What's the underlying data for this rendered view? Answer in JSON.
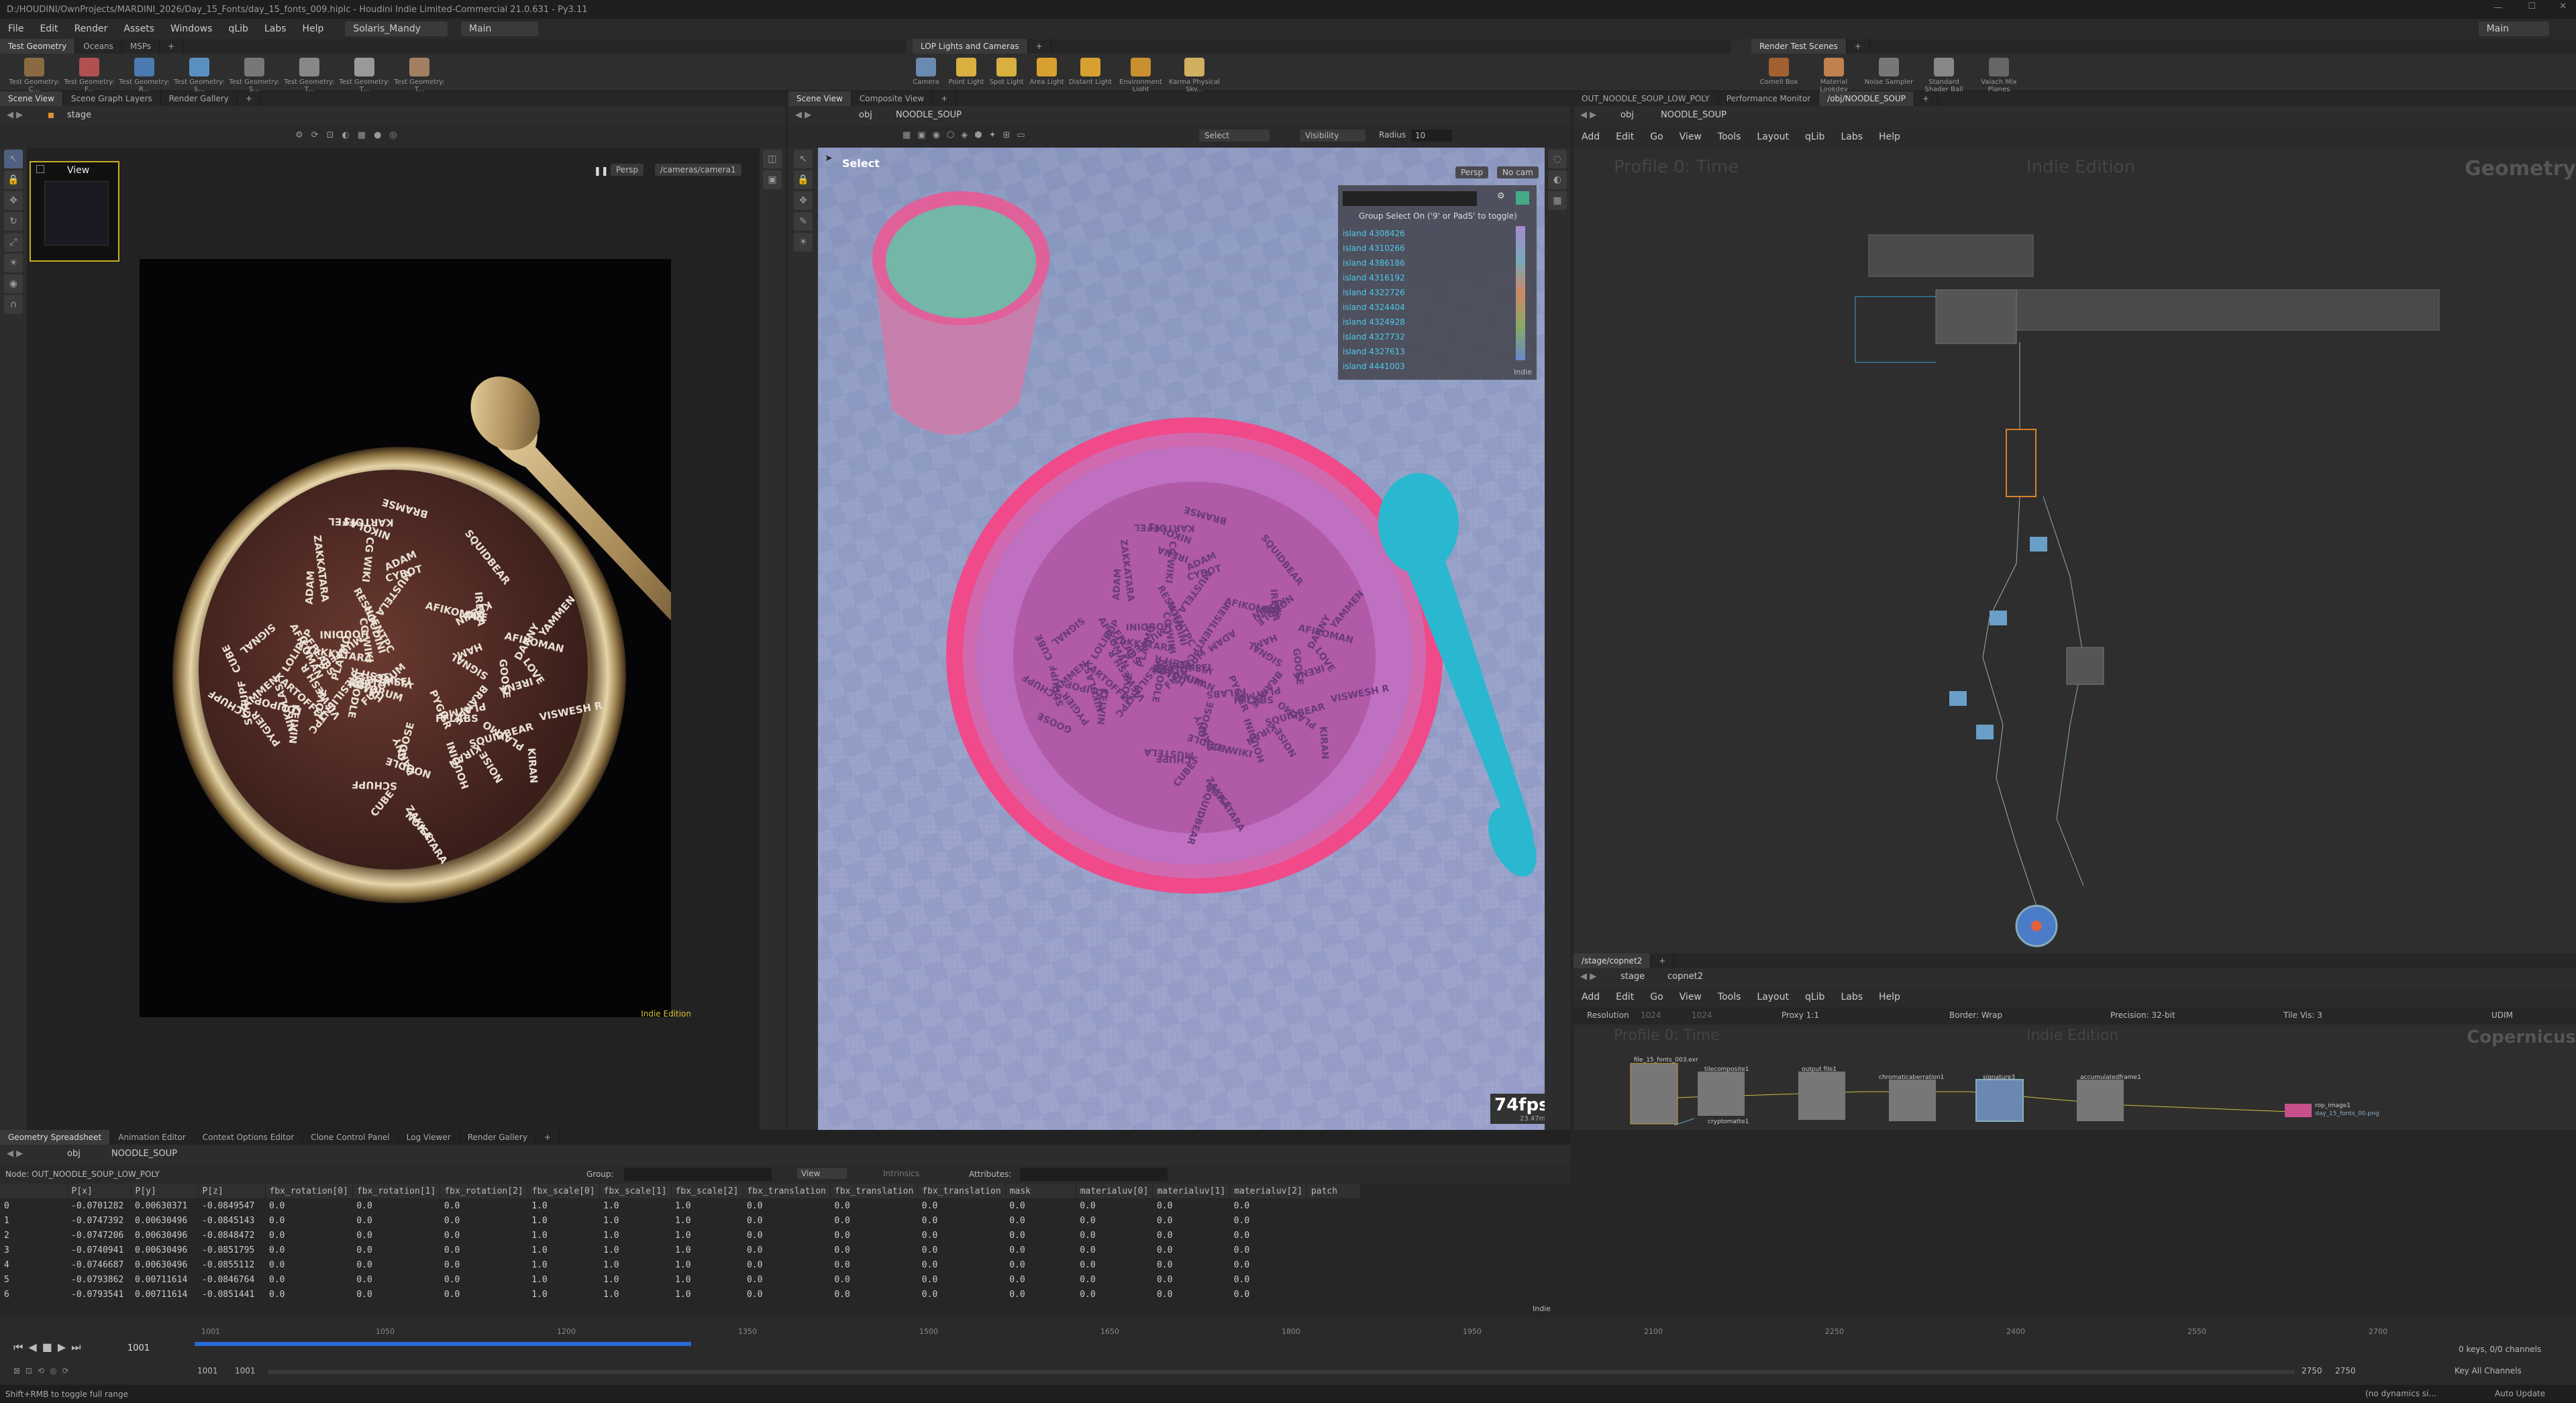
{
  "title": "D:/HOUDINI/OwnProjects/MARDINI_2026/Day_15_Fonts/day_15_fonts_009.hiplc - Houdini Indie Limited-Commercial 21.0.631 - Py3.11",
  "menu": [
    "File",
    "Edit",
    "Render",
    "Assets",
    "Windows",
    "qLib",
    "Labs",
    "Help"
  ],
  "desktop": "Solaris_Mandy",
  "context": "Main",
  "workspace": "Main",
  "shelf_tabs_left": [
    "Test Geometry",
    "Oceans",
    "MSPs",
    "+"
  ],
  "shelf_tools_left": [
    "Test Geometry: C...",
    "Test Geometry: F...",
    "Test Geometry: R...",
    "Test Geometry: S...",
    "Test Geometry: S...",
    "Test Geometry: T...",
    "Test Geometry: T...",
    "Test Geometry: T..."
  ],
  "shelf_tabs_mid": [
    "LOP Lights and Cameras",
    "+"
  ],
  "shelf_tools_mid": [
    "Camera",
    "Point Light",
    "Spot Light",
    "Area Light",
    "Distant Light",
    "Environment Light",
    "Karma Physical Sky..."
  ],
  "shelf_tabs_right": [
    "Render Test Scenes",
    "+"
  ],
  "shelf_tools_right": [
    "Cornell Box",
    "Material Lookdev",
    "Noise Sampler",
    "Standard Shader Ball",
    "Vaiach Mix Planes"
  ],
  "left_pane": {
    "tabs": [
      "Scene View",
      "Scene Graph Layers",
      "Render Gallery",
      "+"
    ],
    "path": "stage",
    "view_label": "View",
    "persp": "Persp",
    "camera": "/cameras/camera1",
    "edition": "Indie Edition"
  },
  "mid_pane": {
    "tabs": [
      "Scene View",
      "Composite View",
      "+"
    ],
    "path_obj": "obj",
    "path_node": "NOODLE_SOUP",
    "mode": "Select",
    "select_dropdown": "Select",
    "visibility": "Visibility",
    "radius_label": "Radius",
    "radius_value": "10",
    "persp": "Persp",
    "nocam": "No cam",
    "fps": "74fps",
    "fps_sub": "23.47ms",
    "popup_title": "Group Select On ('9' or PadS' to toggle)",
    "popup_edition": "Indie",
    "islands": [
      "island 4308426",
      "island 4310266",
      "island 4386186",
      "island 4316192",
      "island 4322726",
      "island 4324404",
      "island 4324928",
      "island 4327732",
      "island 4327613",
      "island 4441003"
    ]
  },
  "right_top": {
    "tabs": [
      "OUT_NOODLE_SOUP_LOW_POLY",
      "Performance Monitor",
      "/obj/NOODLE_SOUP",
      "+"
    ],
    "path_obj": "obj",
    "path_node": "NOODLE_SOUP",
    "menu": [
      "Add",
      "Edit",
      "Go",
      "View",
      "Tools",
      "Layout",
      "qLib",
      "Labs",
      "Help"
    ],
    "watermark_left": "Profile 0: Time",
    "watermark_mid": "Indie Edition",
    "context_label": "Geometry"
  },
  "right_bottom": {
    "tabs": [
      "/stage/copnet2",
      "+"
    ],
    "path_stage": "stage",
    "path_node": "copnet2",
    "menu": [
      "Add",
      "Edit",
      "Go",
      "View",
      "Tools",
      "Layout",
      "qLib",
      "Labs",
      "Help"
    ],
    "resolution_label": "Resolution",
    "res_w": "1024",
    "res_h": "1024",
    "proxy": "Proxy 1:1",
    "border": "Border: Wrap",
    "precision": "Precision: 32-bit",
    "tilevis": "Tile Vis: 3",
    "udim": "UDIM",
    "watermark_left": "Profile 0: Time",
    "watermark_mid": "Indie Edition",
    "context_label": "Copernicus",
    "nodes": [
      "file_15_fonts_003.exr",
      "tilecomposite1",
      "output\nfile1",
      "chromaticaberration1",
      "signature3",
      "accumulatedframe1"
    ],
    "node_extra": "cryptomatte1",
    "rop_label": "rop_image1",
    "rop_sub": "day_15_fonts_00.png"
  },
  "spreadsheet": {
    "tabs": [
      "Geometry Spreadsheet",
      "Animation Editor",
      "Context Options Editor",
      "Clone Control Panel",
      "Log Viewer",
      "Render Gallery",
      "+"
    ],
    "path_obj": "obj",
    "path_node": "NOODLE_SOUP",
    "node_label": "Node: OUT_NOODLE_SOUP_LOW_POLY",
    "group_label": "Group:",
    "view_label": "View",
    "intrinsics": "Intrinsics",
    "attributes": "Attributes:",
    "edition": "Indie",
    "columns": [
      "",
      "P[x]",
      "P[y]",
      "P[z]",
      "fbx_rotation[0]",
      "fbx_rotation[1]",
      "fbx_rotation[2]",
      "fbx_scale[0]",
      "fbx_scale[1]",
      "fbx_scale[2]",
      "fbx_translation",
      "fbx_translation",
      "fbx_translation",
      "mask",
      "materialuv[0]",
      "materialuv[1]",
      "materialuv[2]",
      "patch"
    ],
    "rows": [
      [
        "0",
        "-0.0701282",
        "0.00630371",
        "-0.0849547",
        "0.0",
        "0.0",
        "0.0",
        "1.0",
        "1.0",
        "1.0",
        "0.0",
        "0.0",
        "0.0",
        "0.0",
        "0.0",
        "0.0",
        "0.0",
        ""
      ],
      [
        "1",
        "-0.0747392",
        "0.00630496",
        "-0.0845143",
        "0.0",
        "0.0",
        "0.0",
        "1.0",
        "1.0",
        "1.0",
        "0.0",
        "0.0",
        "0.0",
        "0.0",
        "0.0",
        "0.0",
        "0.0",
        ""
      ],
      [
        "2",
        "-0.0747206",
        "0.00630496",
        "-0.0848472",
        "0.0",
        "0.0",
        "0.0",
        "1.0",
        "1.0",
        "1.0",
        "0.0",
        "0.0",
        "0.0",
        "0.0",
        "0.0",
        "0.0",
        "0.0",
        ""
      ],
      [
        "3",
        "-0.0740941",
        "0.00630496",
        "-0.0851795",
        "0.0",
        "0.0",
        "0.0",
        "1.0",
        "1.0",
        "1.0",
        "0.0",
        "0.0",
        "0.0",
        "0.0",
        "0.0",
        "0.0",
        "0.0",
        ""
      ],
      [
        "4",
        "-0.0746687",
        "0.00630496",
        "-0.0855112",
        "0.0",
        "0.0",
        "0.0",
        "1.0",
        "1.0",
        "1.0",
        "0.0",
        "0.0",
        "0.0",
        "0.0",
        "0.0",
        "0.0",
        "0.0",
        ""
      ],
      [
        "5",
        "-0.0793862",
        "0.00711614",
        "-0.0846764",
        "0.0",
        "0.0",
        "0.0",
        "1.0",
        "1.0",
        "1.0",
        "0.0",
        "0.0",
        "0.0",
        "0.0",
        "0.0",
        "0.0",
        "0.0",
        ""
      ],
      [
        "6",
        "-0.0793541",
        "0.00711614",
        "-0.0851441",
        "0.0",
        "0.0",
        "0.0",
        "1.0",
        "1.0",
        "1.0",
        "0.0",
        "0.0",
        "0.0",
        "0.0",
        "0.0",
        "0.0",
        "0.0",
        ""
      ]
    ]
  },
  "timeline": {
    "frame": "1001",
    "ticks": [
      "1001",
      "1050",
      "1200",
      "1350",
      "1500",
      "1650",
      "1800",
      "1950",
      "2100",
      "2250",
      "2400",
      "2550",
      "2700"
    ],
    "range_start": "1001",
    "range_start2": "1001",
    "range_end": "2750",
    "range_end2": "2750",
    "keys": "0 keys, 0/0 channels",
    "key_all": "Key All Channels"
  },
  "status": {
    "hint": "Shift+RMB to toggle full range",
    "dyn": "(no dynamics si...",
    "auto": "Auto Update"
  },
  "soup_words": [
    "KARTOFFEL",
    "SCHUPF",
    "PLAYMO",
    "LOVE",
    "HOUDINI",
    "ZAKKATARA",
    "AFIKOMAN",
    "VISWESH R",
    "SQUIDBEAR",
    "NOODLE",
    "RESILIENTPC",
    "GOOSE",
    "FFLABS",
    "MUSTELA",
    "KIRAN",
    "IRENA",
    "ADAM",
    "CG WIKI",
    "FUTORUM",
    "PYGIER",
    "HAM",
    "LOLIPOP",
    "KELVIN",
    "NOISE",
    "CUBE",
    "YAMMEN",
    "NIKOLAS",
    "BRAMSE",
    "DANNY",
    "CYBOT",
    "SIGNAL"
  ]
}
